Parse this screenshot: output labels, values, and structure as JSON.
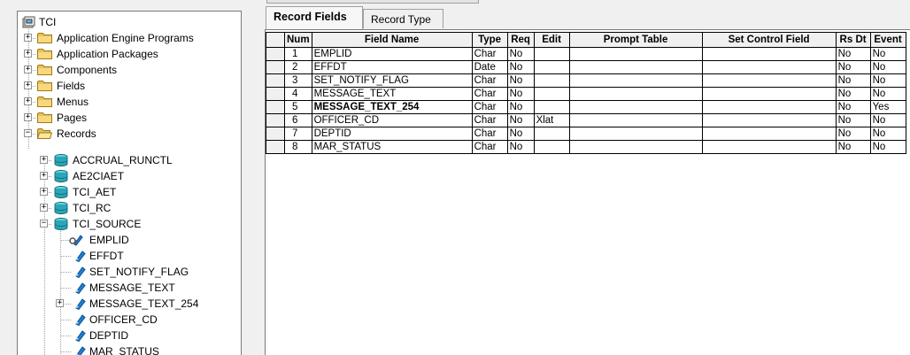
{
  "tree": {
    "root": "TCI",
    "folders": [
      {
        "label": "Application Engine Programs"
      },
      {
        "label": "Application Packages"
      },
      {
        "label": "Components"
      },
      {
        "label": "Fields"
      },
      {
        "label": "Menus"
      },
      {
        "label": "Pages"
      },
      {
        "label": "Records"
      }
    ],
    "records": [
      {
        "label": "ACCRUAL_RUNCTL"
      },
      {
        "label": "AE2CIAET"
      },
      {
        "label": "TCI_AET"
      },
      {
        "label": "TCI_RC"
      },
      {
        "label": "TCI_SOURCE"
      }
    ],
    "fields": [
      {
        "label": "EMPLID"
      },
      {
        "label": "EFFDT"
      },
      {
        "label": "SET_NOTIFY_FLAG"
      },
      {
        "label": "MESSAGE_TEXT"
      },
      {
        "label": "MESSAGE_TEXT_254"
      },
      {
        "label": "OFFICER_CD"
      },
      {
        "label": "DEPTID"
      },
      {
        "label": "MAR_STATUS"
      }
    ]
  },
  "tabs": [
    {
      "label": "Record Fields",
      "active": true
    },
    {
      "label": "Record Type",
      "active": false
    }
  ],
  "grid": {
    "columns": [
      "Num",
      "Field Name",
      "Type",
      "Req",
      "Edit",
      "Prompt Table",
      "Set Control Field",
      "Rs Dt",
      "Event"
    ],
    "rows": [
      {
        "num": "1",
        "field": "EMPLID",
        "type": "Char",
        "req": "No",
        "edit": "",
        "prompt": "",
        "setctl": "",
        "rsdt": "No",
        "event": "No"
      },
      {
        "num": "2",
        "field": "EFFDT",
        "type": "Date",
        "req": "No",
        "edit": "",
        "prompt": "",
        "setctl": "",
        "rsdt": "No",
        "event": "No"
      },
      {
        "num": "3",
        "field": "SET_NOTIFY_FLAG",
        "type": "Char",
        "req": "No",
        "edit": "",
        "prompt": "",
        "setctl": "",
        "rsdt": "No",
        "event": "No"
      },
      {
        "num": "4",
        "field": "MESSAGE_TEXT",
        "type": "Char",
        "req": "No",
        "edit": "",
        "prompt": "",
        "setctl": "",
        "rsdt": "No",
        "event": "No"
      },
      {
        "num": "5",
        "field": "MESSAGE_TEXT_254",
        "type": "Char",
        "req": "No",
        "edit": "",
        "prompt": "",
        "setctl": "",
        "rsdt": "No",
        "event": "Yes",
        "bold": true
      },
      {
        "num": "6",
        "field": "OFFICER_CD",
        "type": "Char",
        "req": "No",
        "edit": "Xlat",
        "prompt": "",
        "setctl": "",
        "rsdt": "No",
        "event": "No"
      },
      {
        "num": "7",
        "field": "DEPTID",
        "type": "Char",
        "req": "No",
        "edit": "",
        "prompt": "",
        "setctl": "",
        "rsdt": "No",
        "event": "No"
      },
      {
        "num": "8",
        "field": "MAR_STATUS",
        "type": "Char",
        "req": "No",
        "edit": "",
        "prompt": "",
        "setctl": "",
        "rsdt": "No",
        "event": "No"
      }
    ]
  },
  "colors": {
    "folder": "#e8c15a",
    "database": "#2aa6b8",
    "field_icon": "#1f7fd6"
  }
}
